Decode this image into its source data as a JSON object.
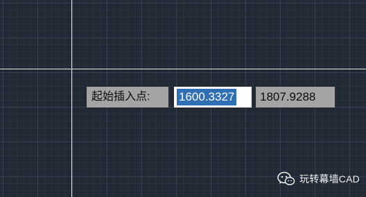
{
  "dynamic_input": {
    "prompt_label": "起始插入点:",
    "x_value": "1600.3327",
    "y_value": "1807.9288"
  },
  "watermark": {
    "text": "玩转幕墙CAD",
    "icon": "wechat-icon"
  },
  "colors": {
    "background": "#212935",
    "crosshair": "#e8ecef",
    "selection": "#2f6fb3",
    "field_gray": "#a4a4a4"
  }
}
